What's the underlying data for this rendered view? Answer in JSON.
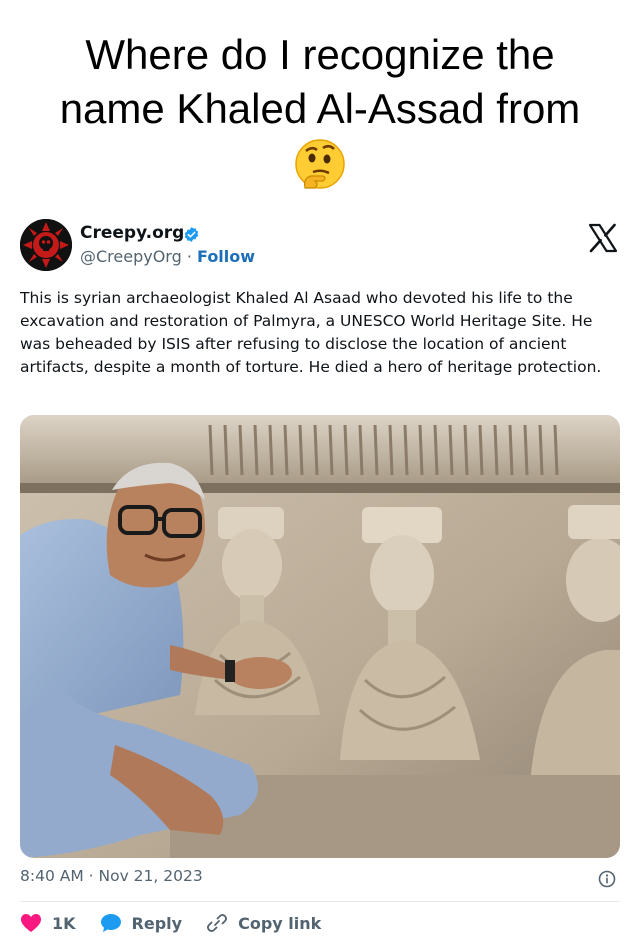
{
  "meme": {
    "title_line1": "Where do I recognize the",
    "title_line2": "name Khaled Al-Assad from",
    "emoji": "thinking-face-emoji"
  },
  "tweet": {
    "display_name": "Creepy.org",
    "handle": "@CreepyOrg",
    "separator": " · ",
    "follow_label": "Follow",
    "text": "This is syrian archaeologist Khaled Al Asaad who devoted his life to the excavation and restoration of Palmyra, a UNESCO World Heritage Site. He was beheaded by ISIS after refusing to disclose the location of ancient artifacts, despite a month of torture. He died a hero of heritage protection.",
    "timestamp": "8:40 AM · Nov 21, 2023",
    "actions": {
      "like_count": "1K",
      "reply_label": "Reply",
      "copy_link_label": "Copy link"
    }
  },
  "colors": {
    "verified_blue": "#1d9bf0",
    "follow_blue": "#1d6fb8",
    "like_red": "#f91880",
    "muted": "#536471"
  }
}
